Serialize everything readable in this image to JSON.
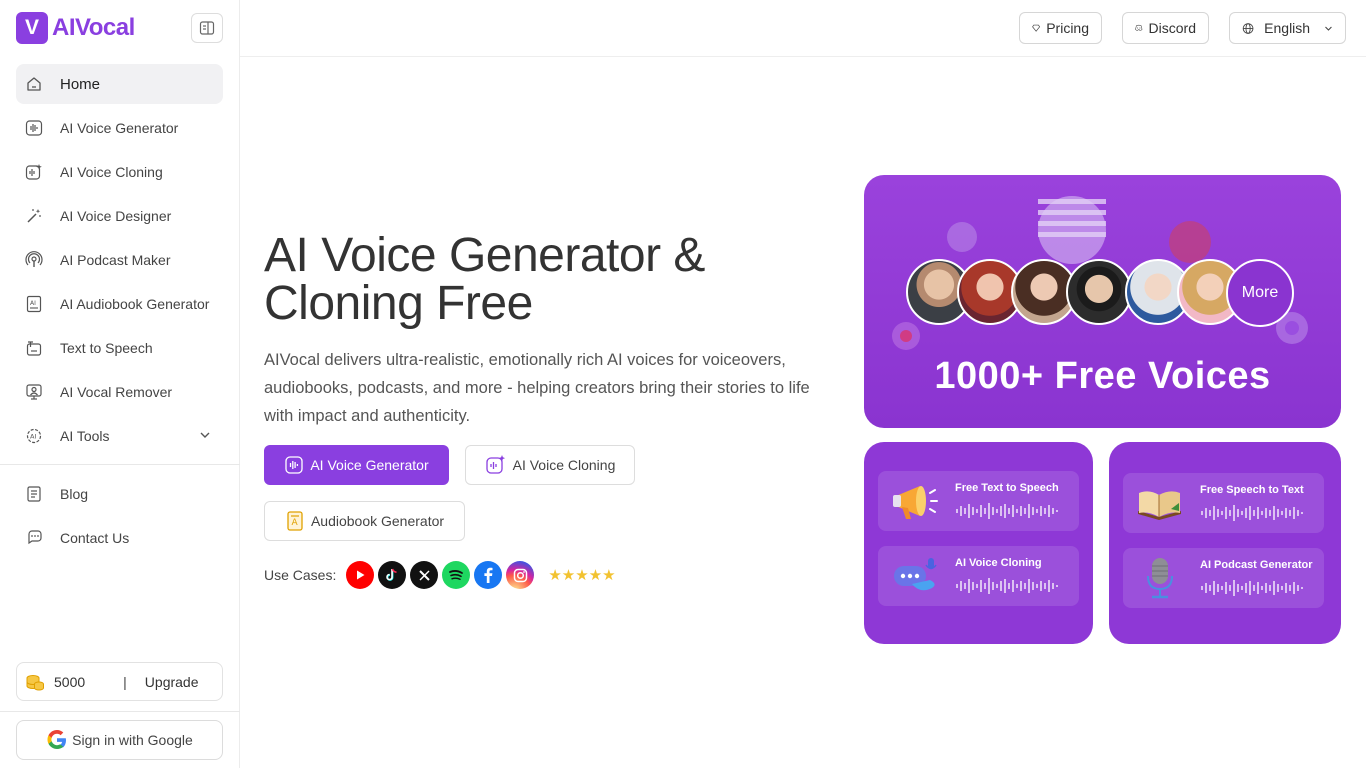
{
  "brand": {
    "badge": "V",
    "name": "AIVocal"
  },
  "sidebar": {
    "items": [
      {
        "label": "Home",
        "icon": "home-icon"
      },
      {
        "label": "AI Voice Generator",
        "icon": "voice-wave-icon"
      },
      {
        "label": "AI Voice Cloning",
        "icon": "voice-clone-icon"
      },
      {
        "label": "AI Voice Designer",
        "icon": "magic-wand-icon"
      },
      {
        "label": "AI Podcast Maker",
        "icon": "podcast-icon"
      },
      {
        "label": "AI Audiobook Generator",
        "icon": "audiobook-icon"
      },
      {
        "label": "Text to Speech",
        "icon": "text-to-speech-icon"
      },
      {
        "label": "AI Vocal Remover",
        "icon": "vocal-remover-icon"
      },
      {
        "label": "AI Tools",
        "icon": "ai-tools-icon"
      }
    ],
    "secondary": [
      {
        "label": "Blog",
        "icon": "blog-icon"
      },
      {
        "label": "Contact Us",
        "icon": "contact-icon"
      }
    ],
    "credits": {
      "amount": "5000",
      "separator": "|",
      "upgrade": "Upgrade"
    },
    "signin": "Sign in with Google"
  },
  "header": {
    "pricing": "Pricing",
    "discord": "Discord",
    "language": "English"
  },
  "hero": {
    "title_line1": "AI Voice Generator &",
    "title_line2": "Cloning Free",
    "description": "AIVocal delivers ultra-realistic, emotionally rich AI voices for voiceovers, audiobooks, podcasts, and more - helping creators bring their stories to life with impact and authenticity.",
    "cta_primary": "AI Voice Generator",
    "cta_cloning": "AI Voice Cloning",
    "cta_audiobook": "Audiobook Generator",
    "use_cases_label": "Use Cases:",
    "rating": "★★★★★",
    "social": [
      "youtube-icon",
      "tiktok-icon",
      "x-icon",
      "spotify-icon",
      "facebook-icon",
      "instagram-icon"
    ]
  },
  "promo": {
    "big_title": "1000+ Free Voices",
    "more": "More",
    "left_card": [
      "Free Text to Speech",
      "AI Voice Cloning"
    ],
    "right_card": [
      "Free Speech to Text",
      "AI Podcast Generator"
    ]
  },
  "colors": {
    "accent": "#8a3fe0",
    "star": "#f2c230"
  }
}
